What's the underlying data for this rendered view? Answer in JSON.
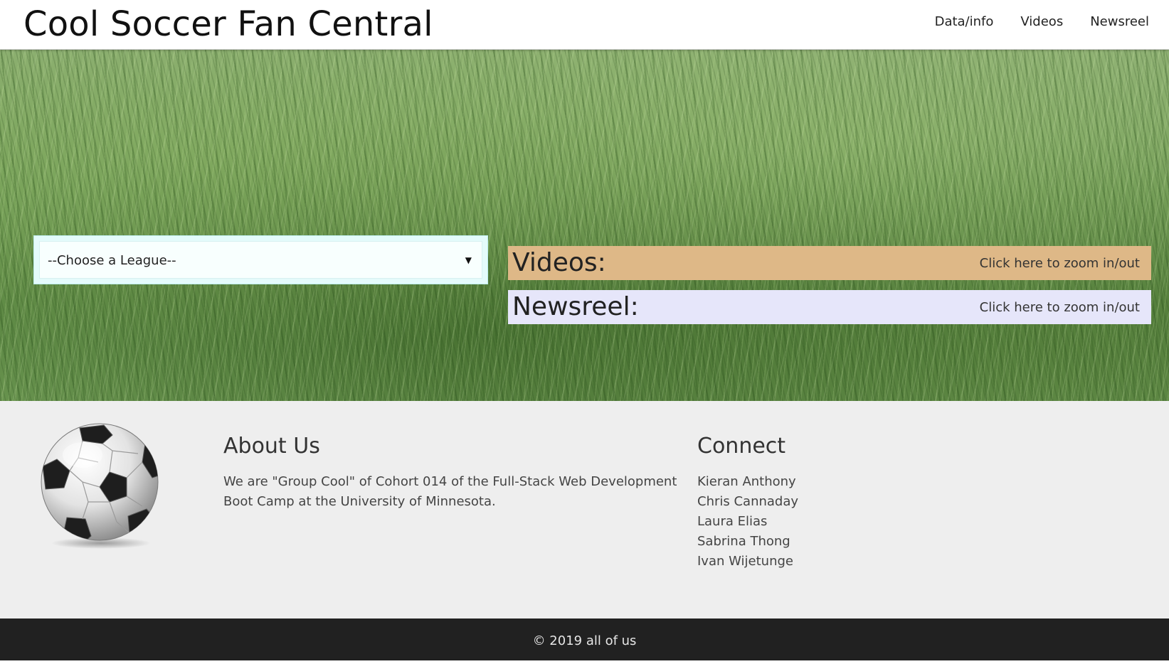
{
  "header": {
    "title": "Cool Soccer Fan Central",
    "nav": [
      {
        "label": "Data/info"
      },
      {
        "label": "Videos"
      },
      {
        "label": "Newsreel"
      }
    ]
  },
  "hero": {
    "league_select": {
      "selected": "--Choose a League--"
    },
    "panels": {
      "videos": {
        "title": "Videos:",
        "zoom_label": "Click here to zoom in/out",
        "color": "#deb887"
      },
      "newsreel": {
        "title": "Newsreel:",
        "zoom_label": "Click here to zoom in/out",
        "color": "#e6e6fa"
      }
    }
  },
  "about": {
    "heading": "About Us",
    "text": "We are \"Group Cool\" of Cohort 014 of the Full-Stack Web Development Boot Camp at the University of Minnesota."
  },
  "connect": {
    "heading": "Connect",
    "members": [
      "Kieran Anthony",
      "Chris Cannaday",
      "Laura Elias",
      "Sabrina Thong",
      "Ivan Wijetunge"
    ]
  },
  "footer": {
    "copyright": "© 2019 all of us"
  },
  "icons": {
    "logo": "soccer-ball-icon",
    "select_caret": "caret-down-icon"
  }
}
